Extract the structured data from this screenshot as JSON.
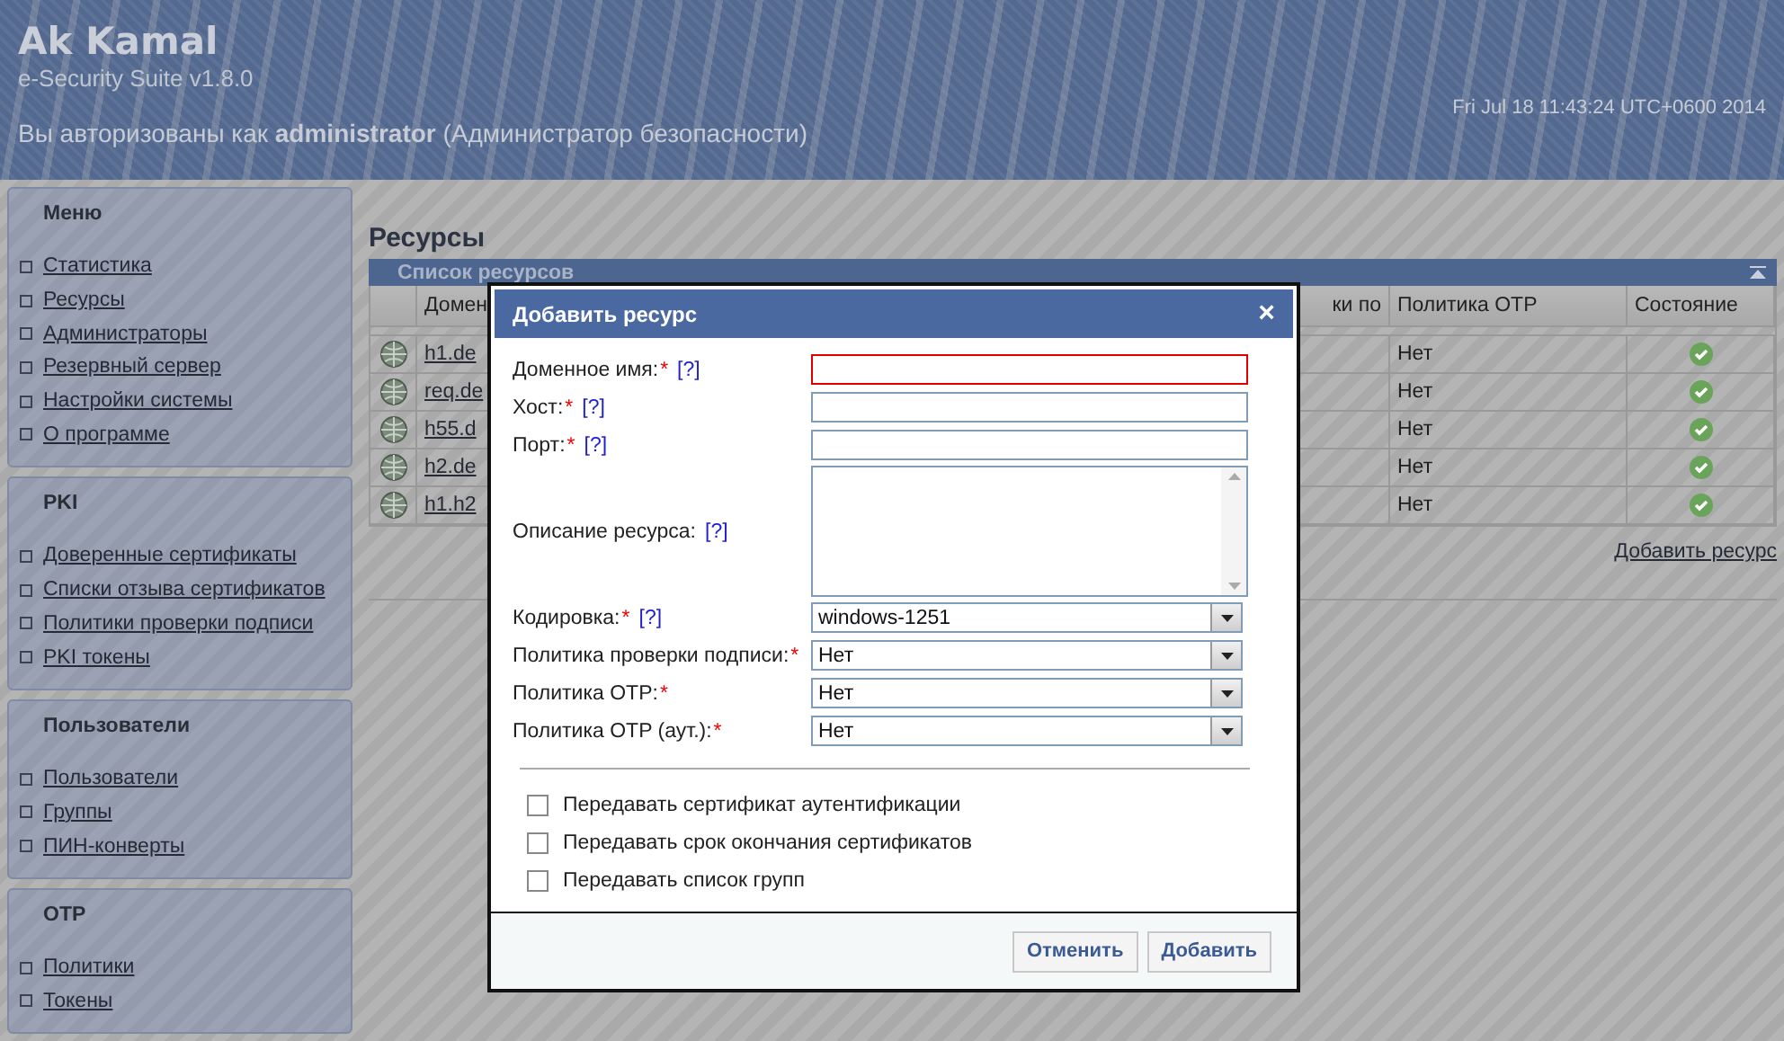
{
  "header": {
    "title": "Ak Kamal",
    "subtitle": "e-Security Suite v1.8.0",
    "login": "Вы авторизованы как **administrator** (Администратор безопасности)",
    "datetime": "Fri Jul 18 11:43:24 UTC+0600 2014"
  },
  "sidebar": [
    {
      "title": "Меню",
      "items": [
        "Статистика",
        "Ресурсы",
        "Администраторы",
        "Резервный сервер",
        "Настройки системы",
        "О программе"
      ]
    },
    {
      "title": "PKI",
      "items": [
        "Доверенные сертификаты",
        "Списки отзыва сертификатов",
        "Политики проверки подписи",
        "PKI токены"
      ]
    },
    {
      "title": "Пользователи",
      "items": [
        "Пользователи",
        "Группы",
        "ПИН-конверты"
      ]
    },
    {
      "title": "OTP",
      "items": [
        "Политики",
        "Токены"
      ]
    }
  ],
  "page_title": "Ресурсы",
  "table": {
    "title": "Список ресурсов",
    "columns": [
      "Домен",
      "ки по",
      "Политика OTP",
      "Состояние"
    ],
    "rows": [
      {
        "domain": "h1.de",
        "otp": "Нет",
        "active": true
      },
      {
        "domain": "req.de",
        "otp": "Нет",
        "active": true
      },
      {
        "domain": "h55.d",
        "otp": "Нет",
        "active": true
      },
      {
        "domain": "h2.de",
        "otp": "Нет",
        "active": true
      },
      {
        "domain": "h1.h2",
        "otp": "Нет",
        "active": true
      }
    ],
    "add_link": "Добавить ресурс"
  },
  "dialog": {
    "title": "Добавить ресурс",
    "close": "×",
    "fields": [
      {
        "kind": "text",
        "label": "Доменное имя:",
        "required_mark": "*",
        "help": "[?]",
        "error": true
      },
      {
        "kind": "text",
        "label": "Хост:",
        "required_mark": "*",
        "help": "[?]",
        "error": false
      },
      {
        "kind": "text",
        "label": "Порт:",
        "required_mark": "*",
        "help": "[?]",
        "error": false
      },
      {
        "kind": "textarea",
        "label": "Описание ресурса:",
        "help": "[?]",
        "error": false
      },
      {
        "kind": "select",
        "label": "Кодировка:",
        "required_mark": "*",
        "help": "[?]",
        "value": "windows-1251"
      },
      {
        "kind": "select",
        "label": "Политика проверки подписи:",
        "required_mark": "*",
        "value": "Нет"
      },
      {
        "kind": "select",
        "label": "Политика OTP:",
        "required_mark": "*",
        "value": "Нет"
      },
      {
        "kind": "select",
        "label": "Политика OTP (аут.):",
        "required_mark": "*",
        "value": "Нет"
      }
    ],
    "checkboxes": [
      {
        "label": "Передавать сертификат аутентификации",
        "checked": false
      },
      {
        "label": "Передавать срок окончания сертификатов",
        "checked": false
      },
      {
        "label": "Передавать список групп",
        "checked": false
      }
    ],
    "buttons": [
      "Отменить",
      "Добавить"
    ]
  }
}
